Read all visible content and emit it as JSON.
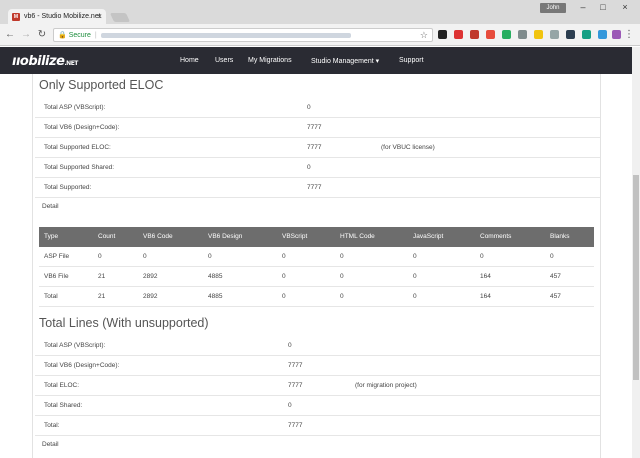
{
  "browser": {
    "tab_title": "vb6 - Studio Mobilize.net",
    "profile_name": "John",
    "secure_label": "Secure"
  },
  "site": {
    "logo_text": "ııobilize",
    "logo_suffix": ".NET",
    "nav": [
      "Home",
      "Users",
      "My Migrations",
      "Studio Management ▾",
      "Support"
    ]
  },
  "section1": {
    "title": "Only Supported ELOC",
    "rows": [
      {
        "label": "Total ASP (VBScript):",
        "value": "0",
        "note": ""
      },
      {
        "label": "Total VB6 (Design+Code):",
        "value": "7777",
        "note": ""
      },
      {
        "label": "Total Supported ELOC:",
        "value": "7777",
        "note": "(for VBUC license)"
      },
      {
        "label": "Total Supported Shared:",
        "value": "0",
        "note": ""
      },
      {
        "label": "Total Supported:",
        "value": "7777",
        "note": ""
      }
    ],
    "detail": "Detail"
  },
  "table": {
    "headers": [
      "Type",
      "Count",
      "VB6 Code",
      "VB6 Design",
      "VBScript",
      "HTML Code",
      "JavaScript",
      "Comments",
      "Blanks"
    ],
    "rows": [
      [
        "ASP File",
        "0",
        "0",
        "0",
        "0",
        "0",
        "0",
        "0",
        "0"
      ],
      [
        "VB6 File",
        "21",
        "2892",
        "4885",
        "0",
        "0",
        "0",
        "164",
        "457"
      ],
      [
        "Total",
        "21",
        "2892",
        "4885",
        "0",
        "0",
        "0",
        "164",
        "457"
      ]
    ]
  },
  "section2": {
    "title": "Total Lines (With unsupported)",
    "rows": [
      {
        "label": "Total ASP (VBScript):",
        "value": "0",
        "note": ""
      },
      {
        "label": "Total VB6 (Design+Code):",
        "value": "7777",
        "note": ""
      },
      {
        "label": "Total ELOC:",
        "value": "7777",
        "note": "(for migration project)"
      },
      {
        "label": "Total Shared:",
        "value": "0",
        "note": ""
      },
      {
        "label": "Total:",
        "value": "7777",
        "note": ""
      }
    ],
    "detail": "Detail"
  }
}
